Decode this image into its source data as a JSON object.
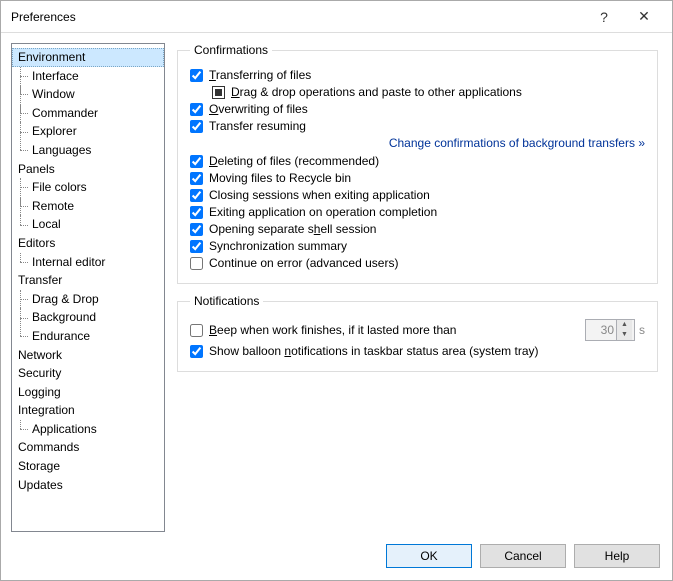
{
  "title": "Preferences",
  "tree": {
    "environment": "Environment",
    "interface": "Interface",
    "window": "Window",
    "commander": "Commander",
    "explorer": "Explorer",
    "languages": "Languages",
    "panels": "Panels",
    "file_colors": "File colors",
    "remote": "Remote",
    "local": "Local",
    "editors": "Editors",
    "internal_editor": "Internal editor",
    "transfer": "Transfer",
    "drag_drop": "Drag & Drop",
    "background": "Background",
    "endurance": "Endurance",
    "network": "Network",
    "security": "Security",
    "logging": "Logging",
    "integration": "Integration",
    "applications": "Applications",
    "commands": "Commands",
    "storage": "Storage",
    "updates": "Updates"
  },
  "confirmations": {
    "legend": "Confirmations",
    "transferring": "Transferring of files",
    "dragdrop": "Drag & drop operations and paste to other applications",
    "overwriting": "Overwriting of files",
    "resuming": "Transfer resuming",
    "link_bg": "Change confirmations of background transfers »",
    "deleting": "Deleting of files (recommended)",
    "moving": "Moving files to Recycle bin",
    "closing": "Closing sessions when exiting application",
    "exiting": "Exiting application on operation completion",
    "shell": "Opening separate shell session",
    "sync": "Synchronization summary",
    "continue": "Continue on error (advanced users)"
  },
  "notifications": {
    "legend": "Notifications",
    "beep": "Beep when work finishes, if it lasted more than",
    "beep_seconds": "30",
    "unit": "s",
    "balloon": "Show balloon notifications in taskbar status area (system tray)"
  },
  "buttons": {
    "ok": "OK",
    "cancel": "Cancel",
    "help": "Help"
  }
}
